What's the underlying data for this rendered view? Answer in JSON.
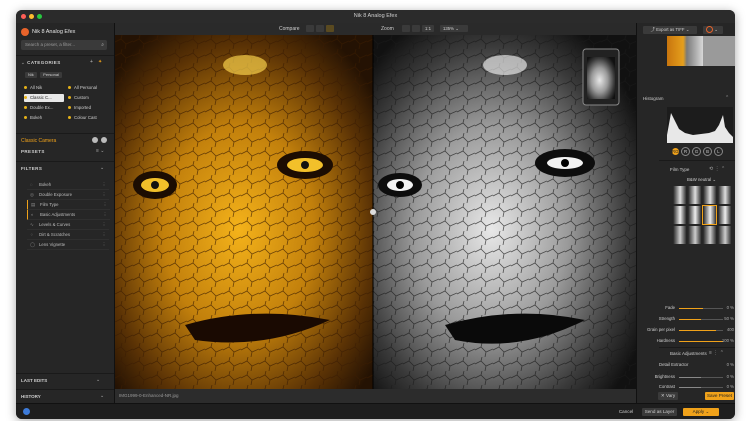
{
  "window": {
    "title": "Nik 8 Analog Efex"
  },
  "app": {
    "name": "Nik 8 Analog Efex"
  },
  "search": {
    "placeholder": "Search a preset, a filter..."
  },
  "categories": {
    "header": "CATEGORIES",
    "tabs": [
      "Nik",
      "Personal"
    ],
    "items": [
      {
        "label": "All Nik",
        "color": "#e6b219"
      },
      {
        "label": "All Personal",
        "color": "#e6b219"
      },
      {
        "label": "Classic C...",
        "color": "#e6b219",
        "selected": true
      },
      {
        "label": "Custom",
        "color": "#e6b219"
      },
      {
        "label": "Double Ex...",
        "color": "#e6b219"
      },
      {
        "label": "Imported",
        "color": "#e6b219"
      },
      {
        "label": "Bokeh",
        "color": "#e6b219"
      },
      {
        "label": "Colour Cast",
        "color": "#e6b219"
      }
    ]
  },
  "active_filter": "Classic Camera",
  "presets_header": "PRESETS",
  "filters": {
    "header": "FILTERS",
    "items": [
      {
        "label": "Bokeh",
        "icon": "bokeh-icon"
      },
      {
        "label": "Double Exposure",
        "icon": "double-exposure-icon"
      },
      {
        "label": "Film Type",
        "icon": "film-icon",
        "active": true
      },
      {
        "label": "Basic Adjustments",
        "icon": "adjust-icon",
        "active": true
      },
      {
        "label": "Levels & Curves",
        "icon": "curves-icon"
      },
      {
        "label": "Dirt & Scratches",
        "icon": "dirt-icon"
      },
      {
        "label": "Lens Vignette",
        "icon": "vignette-icon"
      }
    ]
  },
  "last_edits": "LAST EDITS",
  "history": "HISTORY",
  "toolbar": {
    "compare": "Compare",
    "zoom": "Zoom",
    "zoom_fit": "1:1",
    "zoom_level": "135%"
  },
  "status": {
    "filename": "IMG1999-0-Enhanced-NR.jpg"
  },
  "right": {
    "export": "Export as TIFF",
    "histogram": "Histogram",
    "channels": [
      "RGB",
      "R",
      "G",
      "B",
      "L"
    ],
    "film_type": {
      "header": "Film Type",
      "select": "B&W neutral",
      "sliders": [
        {
          "label": "Fade",
          "value": "0 %",
          "level": 0.55
        },
        {
          "label": "Strength",
          "value": "50 %",
          "level": 0.5
        },
        {
          "label": "Grain per pixel",
          "value": "400",
          "level": 0.85
        },
        {
          "label": "Hardness",
          "value": "100 %",
          "level": 1.0
        }
      ]
    },
    "basic": {
      "header": "Basic Adjustments",
      "detail": "Detail Extractor",
      "detail_val": "0 %",
      "sliders": [
        {
          "label": "Brightness",
          "value": "0 %",
          "level": 0.5
        },
        {
          "label": "Contrast",
          "value": "0 %",
          "level": 0.5
        }
      ]
    },
    "vary": "Vary",
    "save_preset": "Save Preset"
  },
  "bottom": {
    "cancel": "Cancel",
    "send": "Send as Layer",
    "apply": "Apply"
  }
}
